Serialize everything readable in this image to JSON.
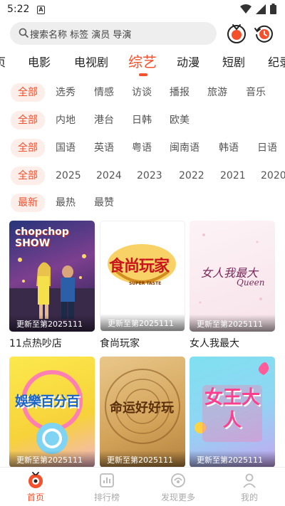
{
  "status": {
    "time": "5:22",
    "a_icon": "A"
  },
  "search": {
    "placeholder": "搜索名称 标签 演员 导演"
  },
  "channels": [
    {
      "label": "页",
      "active": false
    },
    {
      "label": "电影",
      "active": false
    },
    {
      "label": "电视剧",
      "active": false
    },
    {
      "label": "综艺",
      "active": true
    },
    {
      "label": "动漫",
      "active": false
    },
    {
      "label": "短剧",
      "active": false
    },
    {
      "label": "纪录",
      "active": false
    }
  ],
  "filters": {
    "genre": [
      "全部",
      "选秀",
      "情感",
      "访谈",
      "播报",
      "旅游",
      "音乐"
    ],
    "region": [
      "全部",
      "内地",
      "港台",
      "日韩",
      "欧美"
    ],
    "language": [
      "全部",
      "国语",
      "英语",
      "粤语",
      "闽南语",
      "韩语",
      "日语"
    ],
    "year": [
      "全部",
      "2025",
      "2024",
      "2023",
      "2022",
      "2021",
      "2020"
    ],
    "sort": [
      "最新",
      "最热",
      "最赞"
    ]
  },
  "cards": [
    {
      "title": "11点热吵店",
      "update": "更新至第2025111",
      "poster_text": "chopchop SHOW"
    },
    {
      "title": "食尚玩家",
      "update": "更新至第2025111",
      "poster_text": "食尚玩家",
      "poster_sub": "SUPER TASTE"
    },
    {
      "title": "女人我最大",
      "update": "更新至第2025111",
      "poster_text": "女人我最大",
      "poster_sub": "Queen"
    },
    {
      "title": "",
      "update": "更新至第2025111",
      "poster_text": "娛樂百分百"
    },
    {
      "title": "",
      "update": "更新至第2025111",
      "poster_text": "命运好好玩"
    },
    {
      "title": "",
      "update": "更新至第2025111",
      "poster_text": "女王大人"
    }
  ],
  "nav": [
    {
      "label": "首页",
      "icon": "home-icon",
      "active": true
    },
    {
      "label": "排行榜",
      "icon": "ranking-icon",
      "active": false
    },
    {
      "label": "发现更多",
      "icon": "discover-icon",
      "active": false
    },
    {
      "label": "我的",
      "icon": "profile-icon",
      "active": false
    }
  ],
  "colors": {
    "accent": "#f4502c",
    "chip_bg": "#fdeeea",
    "inactive": "#aaaaaa"
  }
}
